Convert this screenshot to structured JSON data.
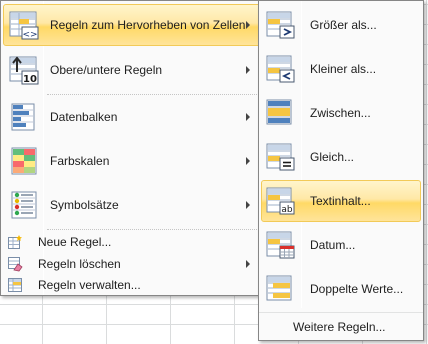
{
  "main_menu": {
    "items": [
      {
        "label": "Regeln zum Hervorheben von Zellen",
        "icon": "highlight-cells-rules-icon",
        "has_submenu": true,
        "highlighted": true
      },
      {
        "label": "Obere/untere Regeln",
        "icon": "top-bottom-rules-icon",
        "has_submenu": true
      },
      {
        "label": "Datenbalken",
        "icon": "data-bars-icon",
        "has_submenu": true
      },
      {
        "label": "Farbskalen",
        "icon": "color-scales-icon",
        "has_submenu": true
      },
      {
        "label": "Symbolsätze",
        "icon": "icon-sets-icon",
        "has_submenu": true
      }
    ],
    "small_items": [
      {
        "label": "Neue Regel...",
        "icon": "new-rule-icon",
        "has_submenu": false
      },
      {
        "label": "Regeln löschen",
        "icon": "clear-rules-icon",
        "has_submenu": true
      },
      {
        "label": "Regeln verwalten...",
        "icon": "manage-rules-icon",
        "has_submenu": false
      }
    ]
  },
  "submenu": {
    "items": [
      {
        "label": "Größer als...",
        "icon": "greater-than-icon"
      },
      {
        "label": "Kleiner als...",
        "icon": "less-than-icon"
      },
      {
        "label": "Zwischen...",
        "icon": "between-icon"
      },
      {
        "label": "Gleich...",
        "icon": "equal-to-icon"
      },
      {
        "label": "Textinhalt...",
        "icon": "text-contains-icon",
        "highlighted": true
      },
      {
        "label": "Datum...",
        "icon": "date-occurring-icon"
      },
      {
        "label": "Doppelte Werte...",
        "icon": "duplicate-values-icon"
      }
    ],
    "more_rules": "Weitere Regeln..."
  },
  "colors": {
    "highlight_border": "#f2ca58",
    "highlight_fill": "#ffe49a",
    "menu_background": "#fafafa",
    "menu_border": "#868686"
  }
}
